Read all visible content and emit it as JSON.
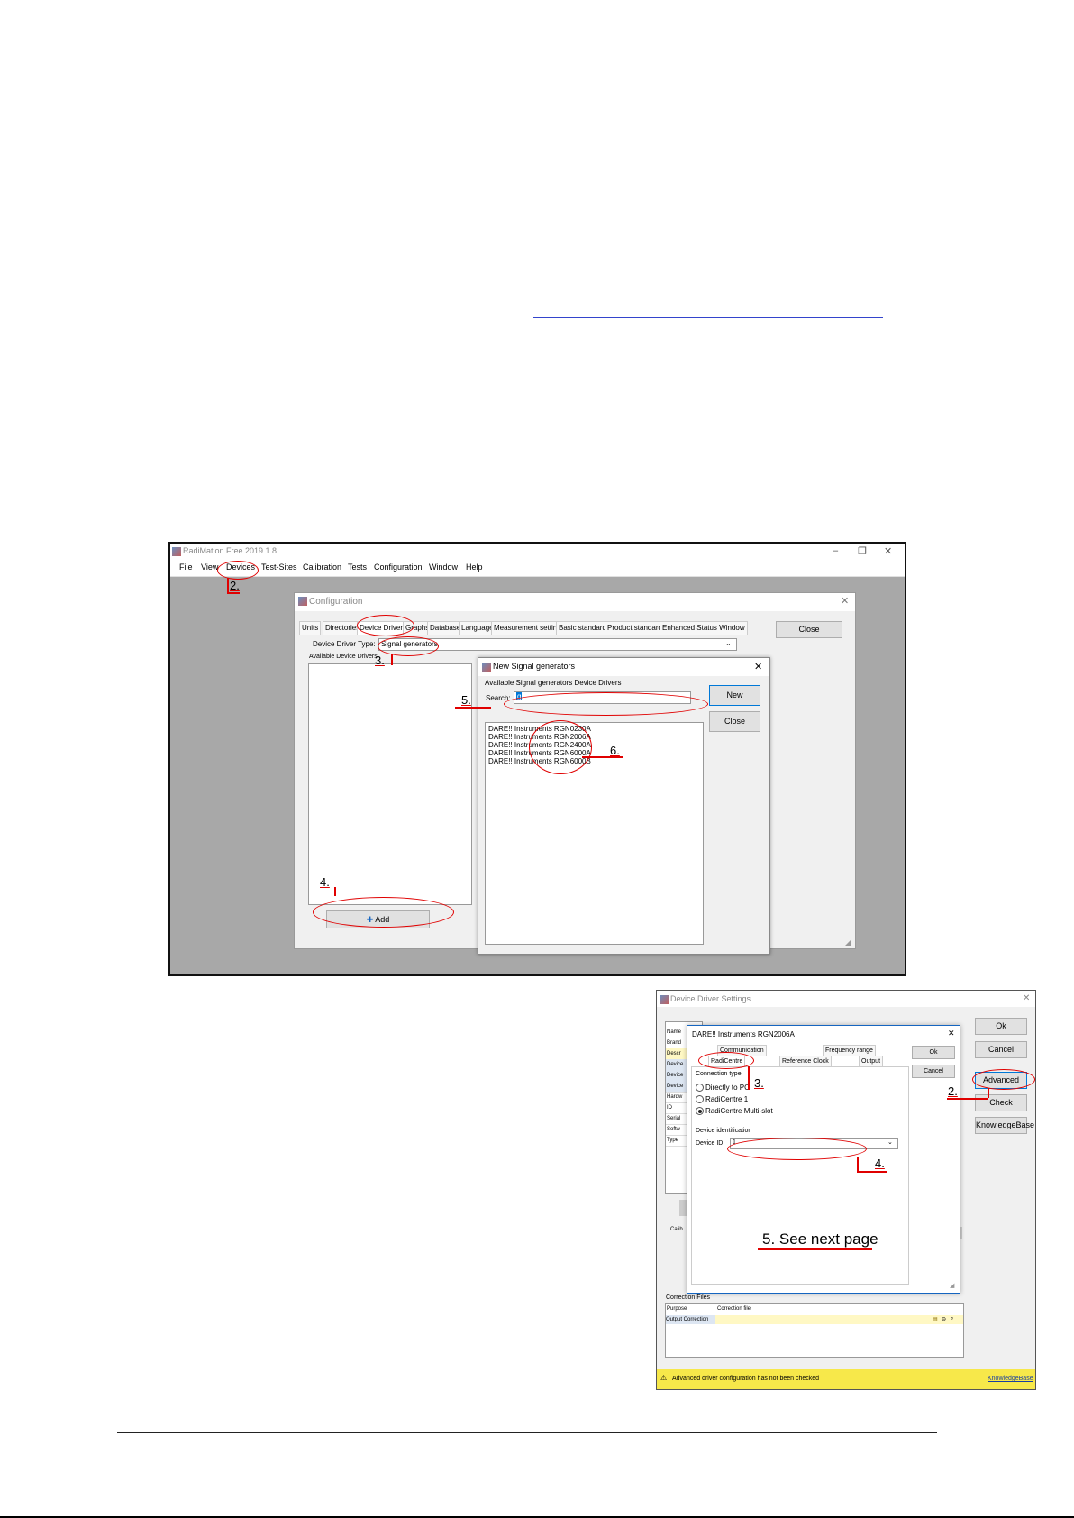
{
  "screenshot1": {
    "app_title": "RadiMation Free 2019.1.8",
    "menu": [
      "File",
      "View",
      "Devices",
      "Test-Sites",
      "Calibration",
      "Tests",
      "Configuration",
      "Window",
      "Help"
    ],
    "config_dialog": {
      "title": "Configuration",
      "tabs": [
        "Units",
        "Directories",
        "Device Drivers",
        "Graphs",
        "Database",
        "Language",
        "Measurement settings",
        "Basic standards",
        "Product standards",
        "Enhanced Status Window"
      ],
      "active_tab": "Device Drivers",
      "close_label": "Close",
      "driver_type_label": "Device Driver Type:",
      "driver_type_value": "Signal generators",
      "available_label": "Available Device Drivers",
      "add_label": "Add"
    },
    "new_dialog": {
      "title": "New Signal generators",
      "available_label": "Available Signal generators Device Drivers",
      "search_label": "Search:",
      "search_value": "g",
      "new_label": "New",
      "close_label": "Close",
      "items": [
        "DARE!! Instruments RGN0230A",
        "DARE!! Instruments RGN2006A",
        "DARE!! Instruments RGN2400A",
        "DARE!! Instruments RGN6000A",
        "DARE!! Instruments RGN6000B"
      ]
    },
    "annotations": [
      "2.",
      "3.",
      "4.",
      "5.",
      "6."
    ]
  },
  "screenshot2": {
    "title": "Device Driver Settings",
    "inner_title": "DARE!! Instruments RGN2006A",
    "tabs_top": [
      "Communication",
      "Frequency range"
    ],
    "tabs_bottom": [
      "RadiCentre",
      "Reference Clock",
      "Output"
    ],
    "ok_label": "Ok",
    "cancel_label": "Cancel",
    "outer_buttons": [
      "Ok",
      "Cancel",
      "Advanced",
      "Check",
      "KnowledgeBase"
    ],
    "left_fields": [
      "Name",
      "Brand",
      "Descr",
      "Device",
      "Device",
      "Device",
      "Hardw",
      "ID",
      "Serial",
      "Softw",
      "Type"
    ],
    "connection_type_label": "Connection type",
    "connection_options": [
      "Directly to PC",
      "RadiCentre 1",
      "RadiCentre Multi-slot"
    ],
    "connection_selected": 2,
    "device_identification_label": "Device identification",
    "device_id_label": "Device ID:",
    "device_id_value": "1",
    "calib_label": "Calib",
    "correction_files_label": "Correction Files",
    "correction_headers": [
      "Purpose",
      "Correction file"
    ],
    "correction_row": "Output Correction",
    "warning_text": "Advanced driver configuration has not been checked",
    "knowledgebase_link": "KnowledgeBase",
    "annotations": [
      "2.",
      "3.",
      "4.",
      "5. See next page"
    ]
  },
  "colors": {
    "annotation": "#e00000",
    "selection": "#0078d7",
    "warning": "#f7e84a"
  }
}
